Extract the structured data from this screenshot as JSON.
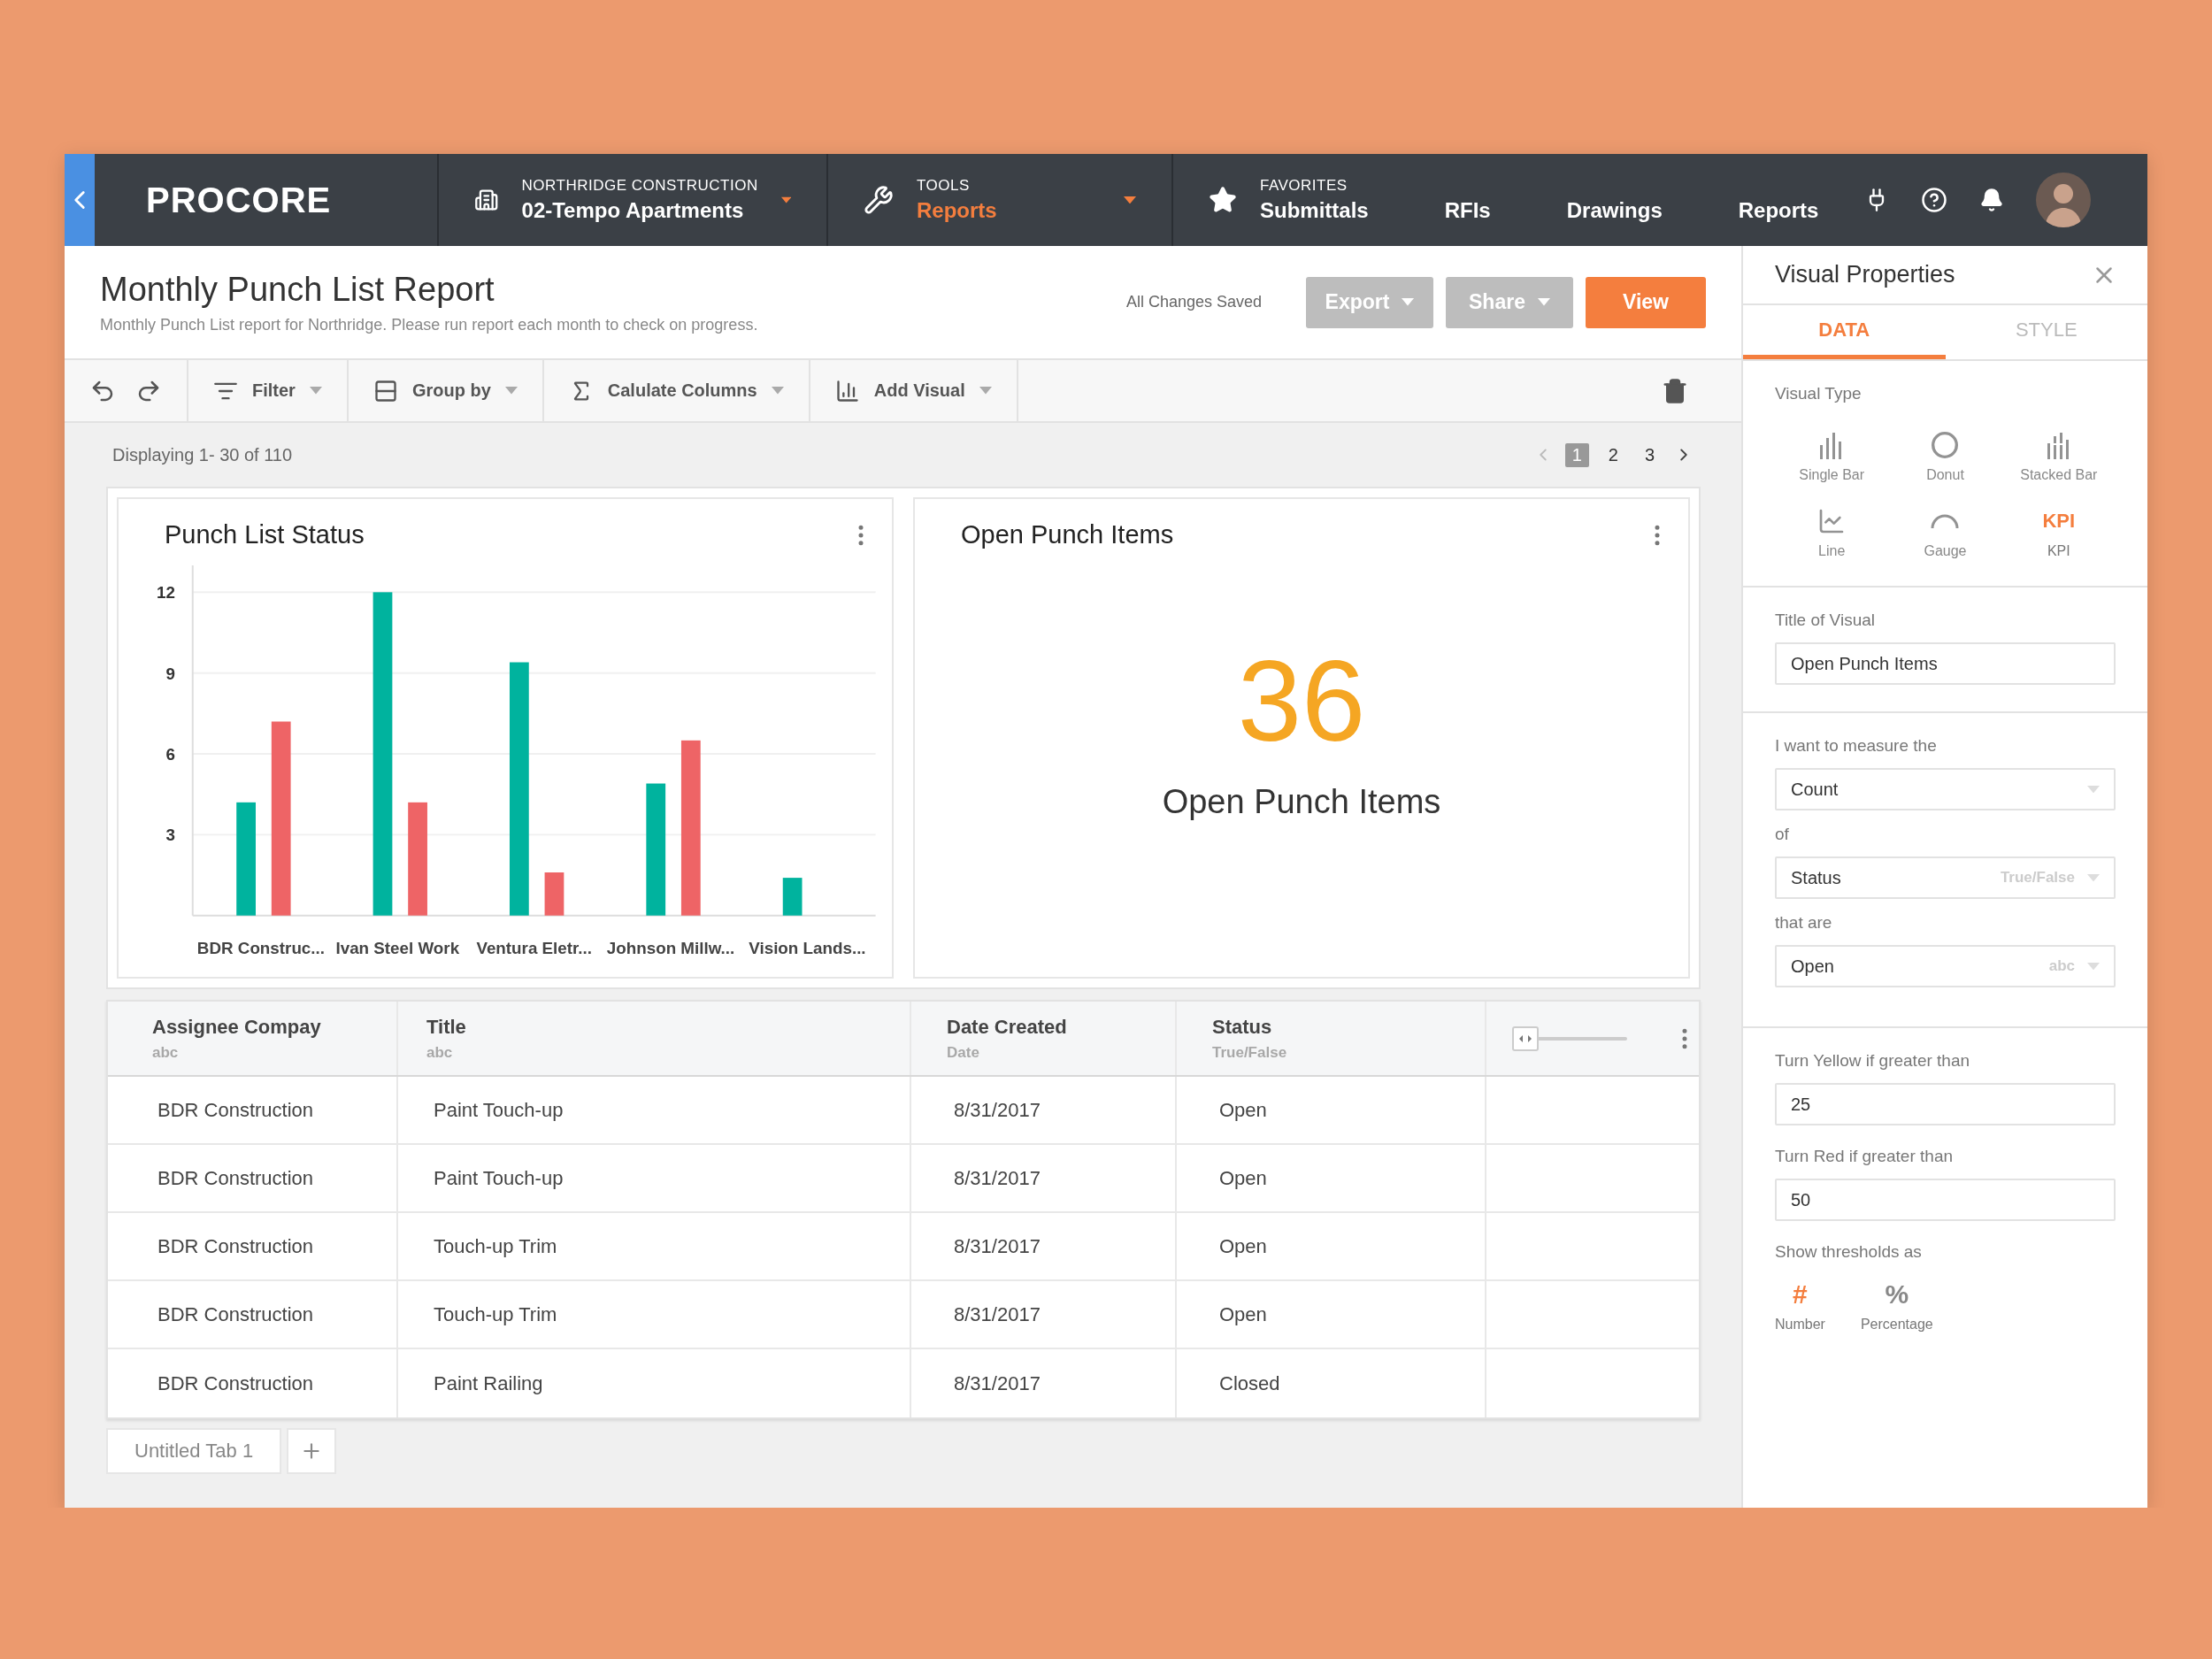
{
  "nav": {
    "logo": "PROCORE",
    "project": {
      "label": "NORTHRIDGE CONSTRUCTION",
      "value": "02-Tempo Apartments"
    },
    "tools": {
      "label": "TOOLS",
      "value": "Reports"
    },
    "favorites": {
      "label": "FAVORITES",
      "items": [
        "Submittals",
        "RFIs",
        "Drawings",
        "Reports"
      ]
    }
  },
  "report": {
    "title": "Monthly Punch List Report",
    "subtitle": "Monthly Punch List report for Northridge. Please run report each month to check on progress.",
    "save_status": "All Changes Saved",
    "buttons": [
      {
        "label": "Export",
        "kind": "dropdown"
      },
      {
        "label": "Share",
        "kind": "dropdown"
      },
      {
        "label": "View",
        "kind": "primary"
      }
    ]
  },
  "toolbar": {
    "items": [
      "Filter",
      "Group by",
      "Calulate Columns",
      "Add Visual"
    ]
  },
  "displaying": "Displaying 1- 30 of 110",
  "pages": [
    {
      "label": "1",
      "selected": true
    },
    {
      "label": "2",
      "selected": false
    },
    {
      "label": "3",
      "selected": false
    }
  ],
  "cards": [
    {
      "kind": "chart",
      "title": "Punch List Status",
      "chart_data": {
        "type": "bar",
        "categories": [
          "BDR Construc...",
          "Ivan Steel Work",
          "Ventura Eletr...",
          "Johnson Millw...",
          "Vision Lands..."
        ],
        "ylim": [
          0,
          13
        ],
        "grid": true,
        "yticks": [
          3,
          6,
          9,
          12
        ],
        "series": [
          {
            "color": "#00b39e",
            "values": [
              4.2,
              12,
              9.4,
              4.9,
              1.4
            ]
          },
          {
            "color": "#ee6466",
            "values": [
              7.2,
              4.2,
              1.6,
              6.5,
              null
            ]
          }
        ]
      }
    },
    {
      "kind": "kpi",
      "title": "Open Punch Items",
      "value": "36",
      "caption": "Open Punch Items"
    }
  ],
  "table": {
    "columns": [
      {
        "name": "Assignee Compay",
        "type": "abc"
      },
      {
        "name": "Title",
        "type": "abc"
      },
      {
        "name": "Date Created",
        "type": "Date"
      },
      {
        "name": "Status",
        "type": "True/False"
      }
    ],
    "width_slider": {
      "level": 0
    },
    "rows": [
      [
        "BDR Construction",
        "Paint Touch-up",
        "8/31/2017",
        "Open"
      ],
      [
        "BDR Construction",
        "Paint Touch-up",
        "8/31/2017",
        "Open"
      ],
      [
        "BDR Construction",
        "Touch-up Trim",
        "8/31/2017",
        "Open"
      ],
      [
        "BDR Construction",
        "Touch-up Trim",
        "8/31/2017",
        "Open"
      ],
      [
        "BDR Construction",
        "Paint Railing",
        "8/31/2017",
        "Closed"
      ]
    ]
  },
  "tabs": [
    {
      "label": "Untitled Tab 1",
      "selected": true
    }
  ],
  "panel": {
    "title": "Visual Properties",
    "tabs": [
      {
        "label": "DATA",
        "selected": true
      },
      {
        "label": "STYLE",
        "selected": false
      }
    ],
    "visual_type_label": "Visual Type",
    "visual_types": [
      {
        "label": "Single Bar",
        "selected": false
      },
      {
        "label": "Donut",
        "selected": false
      },
      {
        "label": "Stacked Bar",
        "selected": false
      },
      {
        "label": "Line",
        "selected": false
      },
      {
        "label": "Gauge",
        "selected": false
      },
      {
        "label": "KPI",
        "selected": true,
        "glyph": "KPI"
      }
    ],
    "title_label": "Title of Visual",
    "title_value": "Open Punch Items",
    "measure_label": "I want to measure the",
    "measure": "Count",
    "of_label": "of",
    "field": "Status",
    "field_type": "True/False",
    "that_are_label": "that are",
    "value": "Open",
    "value_type": "abc",
    "yellow_label": "Turn Yellow if greater than",
    "yellow": "25",
    "red_label": "Turn Red if greater than",
    "red": "50",
    "thresholds_label": "Show thresholds as",
    "threshold_modes": [
      {
        "glyph": "#",
        "label": "Number",
        "selected": true
      },
      {
        "glyph": "%",
        "label": "Percentage",
        "selected": false
      }
    ]
  }
}
